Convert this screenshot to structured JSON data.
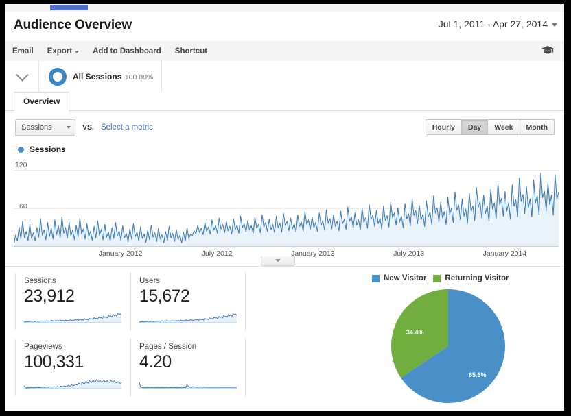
{
  "header": {
    "title": "Audience Overview",
    "date_range": "Jul 1, 2011 - Apr 27, 2014"
  },
  "toolbar": {
    "items": [
      {
        "label": "Email",
        "has_caret": false
      },
      {
        "label": "Export",
        "has_caret": true
      },
      {
        "label": "Add to Dashboard",
        "has_caret": false
      },
      {
        "label": "Shortcut",
        "has_caret": false
      }
    ],
    "help_icon": "graduation-cap-icon"
  },
  "segment": {
    "name": "All Sessions",
    "percent": "100.00%"
  },
  "tabs": [
    {
      "label": "Overview",
      "active": true
    }
  ],
  "metric_selector": {
    "selected": "Sessions",
    "vs_label": "VS.",
    "compare_link": "Select a metric"
  },
  "granularity": {
    "options": [
      "Hourly",
      "Day",
      "Week",
      "Month"
    ],
    "selected": "Day"
  },
  "chart_legend": {
    "series_label": "Sessions"
  },
  "cards": [
    {
      "label": "Sessions",
      "value": "23,912"
    },
    {
      "label": "Users",
      "value": "15,672"
    },
    {
      "label": "Pageviews",
      "value": "100,331"
    },
    {
      "label": "Pages / Session",
      "value": "4.20"
    }
  ],
  "colors": {
    "line_blue": "#3d7ebd",
    "fill_blue": "#eaf2fa",
    "pie_blue": "#4a90c8",
    "pie_green": "#72ad3f",
    "tab_indicator": "#4d72d4",
    "link_blue": "#3a6fb5"
  },
  "chart_data": [
    {
      "type": "line",
      "title": "Sessions",
      "xlabel": "",
      "ylabel": "Sessions",
      "ylim": [
        0,
        140
      ],
      "yticks": [
        60,
        120
      ],
      "grid": true,
      "legend": [
        "Sessions"
      ],
      "legend_position": "top-left",
      "x_tick_labels": [
        "January 2012",
        "July 2012",
        "January 2013",
        "July 2013",
        "January 2014"
      ],
      "x_tick_positions": [
        0.196,
        0.373,
        0.549,
        0.725,
        0.901
      ],
      "x_range": [
        "Jul 1, 2011",
        "Apr 27, 2014"
      ],
      "series": [
        {
          "name": "Sessions",
          "values": [
            2,
            18,
            9,
            31,
            12,
            40,
            14,
            24,
            10,
            35,
            13,
            22,
            9,
            30,
            15,
            44,
            18,
            26,
            11,
            38,
            16,
            29,
            12,
            42,
            19,
            33,
            14,
            47,
            21,
            30,
            13,
            39,
            17,
            26,
            11,
            34,
            15,
            45,
            20,
            28,
            12,
            36,
            16,
            24,
            10,
            32,
            14,
            41,
            18,
            27,
            11,
            35,
            15,
            23,
            9,
            30,
            13,
            38,
            17,
            25,
            10,
            33,
            14,
            21,
            8,
            28,
            12,
            36,
            16,
            23,
            9,
            31,
            13,
            20,
            7,
            26,
            11,
            34,
            15,
            22,
            8,
            29,
            12,
            19,
            6,
            24,
            10,
            32,
            14,
            21,
            8,
            27,
            11,
            18,
            6,
            23,
            9,
            30,
            13,
            20,
            18,
            25,
            20,
            34,
            22,
            29,
            19,
            38,
            24,
            31,
            20,
            42,
            26,
            33,
            21,
            45,
            28,
            35,
            22,
            40,
            25,
            32,
            20,
            44,
            27,
            34,
            21,
            48,
            30,
            36,
            23,
            41,
            26,
            33,
            21,
            46,
            29,
            35,
            22,
            50,
            31,
            38,
            24,
            43,
            27,
            35,
            22,
            48,
            30,
            37,
            23,
            52,
            33,
            40,
            25,
            45,
            28,
            36,
            23,
            50,
            32,
            39,
            24,
            55,
            35,
            42,
            27,
            47,
            30,
            38,
            24,
            53,
            34,
            41,
            26,
            58,
            37,
            44,
            28,
            50,
            32,
            40,
            25,
            56,
            36,
            43,
            27,
            62,
            40,
            47,
            30,
            53,
            34,
            42,
            27,
            60,
            38,
            46,
            29,
            66,
            43,
            50,
            32,
            57,
            36,
            45,
            28,
            64,
            41,
            49,
            31,
            70,
            46,
            53,
            34,
            61,
            39,
            48,
            30,
            68,
            44,
            52,
            33,
            75,
            49,
            57,
            36,
            65,
            42,
            51,
            32,
            72,
            47,
            55,
            35,
            80,
            53,
            61,
            39,
            70,
            45,
            55,
            35,
            78,
            51,
            60,
            38,
            86,
            57,
            66,
            42,
            75,
            48,
            59,
            37,
            84,
            55,
            64,
            41,
            93,
            62,
            71,
            45,
            81,
            52,
            64,
            40,
            90,
            59,
            69,
            44,
            100,
            66,
            76,
            48,
            87,
            56,
            69,
            43,
            97,
            64,
            74,
            47,
            108,
            71,
            82,
            52,
            94,
            61,
            75,
            47,
            105,
            69,
            80,
            51,
            116,
            77,
            88,
            56,
            101,
            66,
            81,
            50,
            113,
            74,
            86
          ]
        }
      ]
    },
    {
      "type": "pie",
      "title": "New vs Returning Visitors",
      "labels": [
        "New Visitor",
        "Returning Visitor"
      ],
      "values": [
        65.6,
        34.4
      ],
      "value_labels": [
        "65.6%",
        "34.4%"
      ],
      "colors": [
        "#4a90c8",
        "#72ad3f"
      ],
      "legend_position": "top",
      "start_angle_deg": 0,
      "direction": "clockwise"
    },
    {
      "type": "line",
      "title": "Sessions sparkline",
      "ylim": [
        0,
        100
      ],
      "grid": false,
      "series": [
        {
          "name": "Sessions",
          "values": [
            8,
            6,
            9,
            7,
            10,
            8,
            12,
            9,
            11,
            8,
            13,
            10,
            9,
            12,
            10,
            14,
            11,
            13,
            10,
            16,
            12,
            14,
            11,
            18,
            13,
            15,
            12,
            17,
            14,
            16,
            13,
            19,
            15,
            17,
            14,
            21,
            16,
            18,
            15,
            23,
            18,
            20,
            16,
            25,
            19,
            22,
            17,
            27,
            21,
            24,
            19,
            30,
            23,
            26,
            21,
            34,
            27,
            30,
            24,
            38,
            30,
            34,
            27,
            43,
            35,
            39,
            31,
            48,
            40,
            44,
            36,
            55,
            46,
            50,
            42,
            62,
            53,
            58,
            48,
            70,
            60,
            66,
            55
          ]
        }
      ]
    },
    {
      "type": "line",
      "title": "Users sparkline",
      "ylim": [
        0,
        100
      ],
      "grid": false,
      "series": [
        {
          "name": "Users",
          "values": [
            7,
            5,
            8,
            6,
            9,
            7,
            11,
            8,
            10,
            7,
            12,
            9,
            8,
            11,
            9,
            13,
            10,
            12,
            9,
            15,
            11,
            13,
            10,
            17,
            12,
            14,
            11,
            16,
            13,
            15,
            12,
            18,
            14,
            16,
            13,
            20,
            15,
            17,
            14,
            22,
            17,
            19,
            15,
            24,
            18,
            21,
            16,
            26,
            20,
            23,
            18,
            29,
            22,
            25,
            20,
            33,
            26,
            29,
            23,
            37,
            29,
            33,
            26,
            42,
            34,
            38,
            30,
            47,
            39,
            43,
            35,
            54,
            45,
            49,
            41,
            61,
            52,
            57,
            47,
            69,
            59,
            65,
            54
          ]
        }
      ]
    },
    {
      "type": "line",
      "title": "Pageviews sparkline",
      "ylim": [
        0,
        100
      ],
      "grid": false,
      "series": [
        {
          "name": "Pageviews",
          "values": [
            22,
            9,
            6,
            5,
            7,
            6,
            9,
            7,
            6,
            8,
            7,
            10,
            8,
            7,
            9,
            8,
            11,
            9,
            8,
            12,
            10,
            9,
            13,
            11,
            10,
            14,
            12,
            11,
            16,
            13,
            12,
            18,
            15,
            14,
            20,
            17,
            16,
            24,
            20,
            19,
            28,
            23,
            22,
            34,
            28,
            26,
            40,
            33,
            31,
            46,
            38,
            36,
            52,
            43,
            40,
            58,
            48,
            45,
            62,
            51,
            48,
            66,
            54,
            51,
            60,
            49,
            47,
            64,
            52,
            50,
            58,
            47,
            45,
            62,
            51,
            48,
            55,
            45,
            43,
            50,
            41,
            39,
            44
          ]
        }
      ]
    },
    {
      "type": "line",
      "title": "Pages / Session sparkline",
      "ylim": [
        0,
        100
      ],
      "grid": false,
      "series": [
        {
          "name": "Pages / Session",
          "values": [
            48,
            12,
            8,
            7,
            6,
            7,
            6,
            8,
            7,
            6,
            7,
            8,
            6,
            7,
            6,
            8,
            7,
            6,
            7,
            8,
            6,
            7,
            6,
            8,
            7,
            6,
            8,
            7,
            6,
            7,
            8,
            6,
            7,
            6,
            8,
            7,
            6,
            7,
            8,
            6,
            28,
            18,
            12,
            10,
            9,
            14,
            11,
            10,
            12,
            9,
            11,
            10,
            12,
            9,
            11,
            10,
            9,
            11,
            9,
            10,
            9,
            11,
            9,
            10,
            9,
            10,
            9,
            10,
            9,
            10,
            9,
            10,
            9,
            10,
            9,
            10,
            9,
            10,
            9,
            10,
            9,
            10,
            9
          ]
        }
      ]
    }
  ]
}
